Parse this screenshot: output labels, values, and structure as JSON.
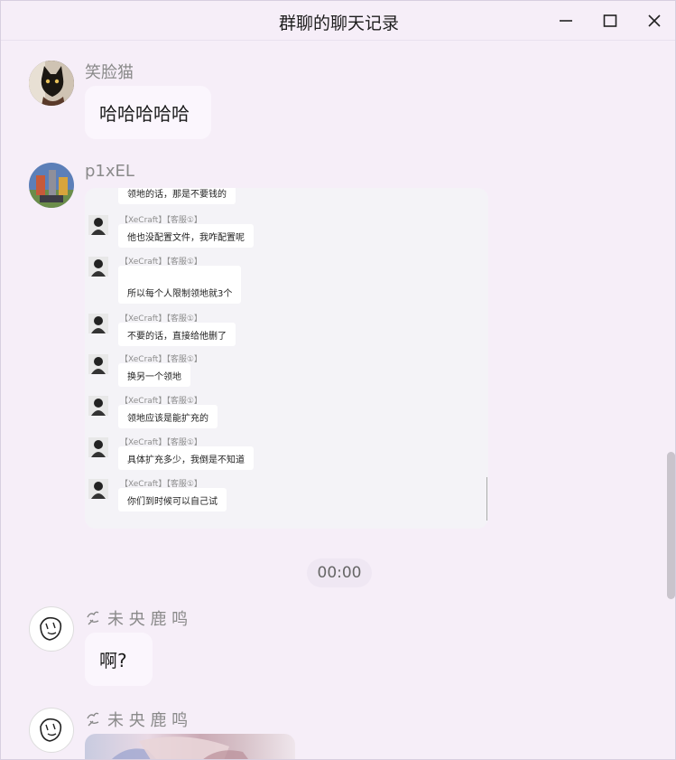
{
  "window": {
    "title": "群聊的聊天记录",
    "controls": [
      "minimize-icon",
      "maximize-icon",
      "close-icon"
    ]
  },
  "messages": [
    {
      "sender": "笑脸猫",
      "text": "哈哈哈哈哈"
    },
    {
      "sender": "p1xEL",
      "screenshot": {
        "first_line": "领地的话，那是不要钱的",
        "rows": [
          {
            "name": "【XeCraft】【客服①】",
            "text": "他也没配置文件，我咋配置呢"
          },
          {
            "name": "【XeCraft】【客服①】",
            "text": "所以每个人限制领地就3个"
          },
          {
            "name": "【XeCraft】【客服①】",
            "text": "不要的话，直接给他删了"
          },
          {
            "name": "【XeCraft】【客服①】",
            "text": "换另一个领地"
          },
          {
            "name": "【XeCraft】【客服①】",
            "text": "领地应该是能扩充的"
          },
          {
            "name": "【XeCraft】【客服①】",
            "text": "具体扩充多少，我倒是不知道"
          },
          {
            "name": "【XeCraft】【客服①】",
            "text": "你们到时候可以自己试"
          }
        ]
      }
    },
    {
      "timestamp": "00:00"
    },
    {
      "sender": "未央鹿鸣",
      "sender_display": "未 央 鹿 鸣",
      "text": "啊?"
    },
    {
      "sender": "未央鹿鸣",
      "sender_display": "未 央 鹿 鸣",
      "image": "anime-image"
    }
  ]
}
